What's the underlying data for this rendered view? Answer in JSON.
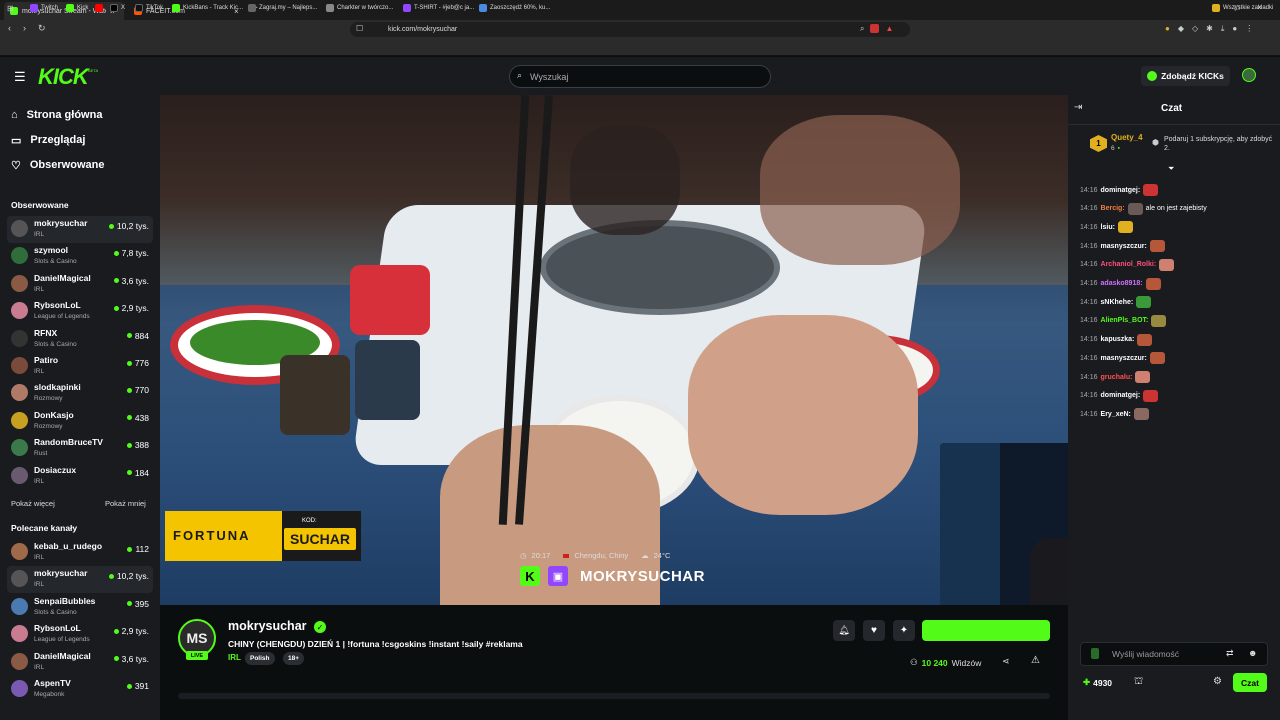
{
  "browser": {
    "tabs": [
      {
        "title": "mokrysuchar Stream - Watch",
        "active": true
      },
      {
        "title": "FACEIT.com",
        "active": false
      }
    ],
    "url": "kick.com/mokrysuchar",
    "bookmarks": [
      "Twitch",
      "Kick",
      "X",
      "TikTok",
      "KickBans - Track Kic...",
      "Zagraj.my – Najleps...",
      "Charkter w twórczo...",
      "T-SHIRT - #jeb@c ja...",
      "Zaoszczędź 60%, ku..."
    ],
    "all_bookmarks": "Wszystkie zakładki",
    "colors": {
      "bg": "#0b0e0f",
      "panel": "#191b1f",
      "accent": "#53fc18"
    }
  },
  "header": {
    "logo": "KICK",
    "logo_badge": "BETA",
    "search_placeholder": "Wyszukaj",
    "get_kicks": "Zdobądź KICKs"
  },
  "sidebar": {
    "nav": [
      "Strona główna",
      "Przeglądaj",
      "Obserwowane"
    ],
    "followed_title": "Obserwowane",
    "followed": [
      {
        "name": "mokrysuchar",
        "category": "IRL",
        "viewers": "10,2 tys.",
        "color": "#555"
      },
      {
        "name": "szymool",
        "category": "Slots & Casino",
        "viewers": "7,8 tys.",
        "color": "#2f6e3a"
      },
      {
        "name": "DanielMagical",
        "category": "IRL",
        "viewers": "3,6 tys.",
        "color": "#8a5a44"
      },
      {
        "name": "RybsonLoL",
        "category": "League of Legends",
        "viewers": "2,9 tys.",
        "color": "#c97b8f"
      },
      {
        "name": "RFNX",
        "category": "Slots & Casino",
        "viewers": "884",
        "color": "#333"
      },
      {
        "name": "Patiro",
        "category": "IRL",
        "viewers": "776",
        "color": "#7a4b3a"
      },
      {
        "name": "slodkapinki",
        "category": "Rozmowy",
        "viewers": "770",
        "color": "#b07a66"
      },
      {
        "name": "DonKasjo",
        "category": "Rozmowy",
        "viewers": "438",
        "color": "#c8a020"
      },
      {
        "name": "RandomBruceTV",
        "category": "Rust",
        "viewers": "388",
        "color": "#3a7a4a"
      },
      {
        "name": "Dosiaczux",
        "category": "IRL",
        "viewers": "184",
        "color": "#6a5a70"
      }
    ],
    "show_more": "Pokaż więcej",
    "show_less": "Pokaż mniej",
    "recommended_title": "Polecane kanały",
    "recommended": [
      {
        "name": "kebab_u_rudego",
        "category": "IRL",
        "viewers": "112",
        "color": "#a06a4a"
      },
      {
        "name": "mokrysuchar",
        "category": "IRL",
        "viewers": "10,2 tys.",
        "color": "#555"
      },
      {
        "name": "SenpaiBubbles",
        "category": "Slots & Casino",
        "viewers": "395",
        "color": "#4a7ab0"
      },
      {
        "name": "RybsonLoL",
        "category": "League of Legends",
        "viewers": "2,9 tys.",
        "color": "#c97b8f"
      },
      {
        "name": "DanielMagical",
        "category": "IRL",
        "viewers": "3,6 tys.",
        "color": "#8a5a44"
      },
      {
        "name": "AspenTV",
        "category": "Megabonk",
        "viewers": "391",
        "color": "#7a5ab0"
      }
    ]
  },
  "video": {
    "sponsor_brand": "FORTUNA",
    "sponsor_code_label": "KOD:",
    "sponsor_code": "SUCHAR",
    "overlay_time": "20:17",
    "overlay_location": "Chengdu, Chiny",
    "overlay_temp": "24°C",
    "overlay_name": "MOKRYSUCHAR"
  },
  "stream": {
    "avatar_initials": "MS",
    "live": "LIVE",
    "streamer": "mokrysuchar",
    "title": "CHINY (CHENGDU) DZIEŃ 1 | !fortuna !csgoskins !instant !saily #reklama",
    "category": "IRL",
    "tags": [
      "Polish",
      "18+"
    ],
    "viewers": "10 240",
    "viewers_label": "Widzów"
  },
  "chat": {
    "title": "Czat",
    "top_gifter": "Quety_4",
    "top_gifter_count": "6",
    "top_gifter_rank": "1",
    "gift_promo": "Podaruj 1 subskrypcję, aby zdobyć 2.",
    "messages": [
      {
        "time": "14:16",
        "user": "dominatgej:",
        "color": "#fff",
        "text": "",
        "emote": "#c33"
      },
      {
        "time": "14:16",
        "user": "Bercig:",
        "color": "#f07d3f",
        "text": "ale on jest zajebisty",
        "emote": "#6a5a55"
      },
      {
        "time": "14:16",
        "user": "lsiu:",
        "color": "#fff",
        "text": "",
        "emote": "#e0b020"
      },
      {
        "time": "14:16",
        "user": "masnyszczur:",
        "color": "#fff",
        "text": "",
        "emote": "#b5583a"
      },
      {
        "time": "14:16",
        "user": "Archaniol_Rolki:",
        "color": "#ff4f7a",
        "text": "",
        "emote": "#d08070"
      },
      {
        "time": "14:16",
        "user": "adasko8918:",
        "color": "#d070ff",
        "text": "",
        "emote": "#b5583a"
      },
      {
        "time": "14:16",
        "user": "sNKhehe:",
        "color": "#fff",
        "text": "",
        "emote": "#3a9a3a"
      },
      {
        "time": "14:16",
        "user": "AlienPls_BOT:",
        "color": "#53fc18",
        "text": "",
        "emote": "#9a8a40"
      },
      {
        "time": "14:16",
        "user": "kapuszka:",
        "color": "#fff",
        "text": "",
        "emote": "#b5583a"
      },
      {
        "time": "14:16",
        "user": "masnyszczur:",
        "color": "#fff",
        "text": "",
        "emote": "#b5583a"
      },
      {
        "time": "14:16",
        "user": "gruchalu:",
        "color": "#ff4f4f",
        "text": "",
        "emote": "#d08070"
      },
      {
        "time": "14:16",
        "user": "dominatgej:",
        "color": "#fff",
        "text": "",
        "emote": "#c33"
      },
      {
        "time": "14:16",
        "user": "Ery_xeN:",
        "color": "#fff",
        "text": "",
        "emote": "#8a6a60"
      }
    ],
    "input_placeholder": "Wyślij wiadomość",
    "points": "4930",
    "send_label": "Czat"
  }
}
